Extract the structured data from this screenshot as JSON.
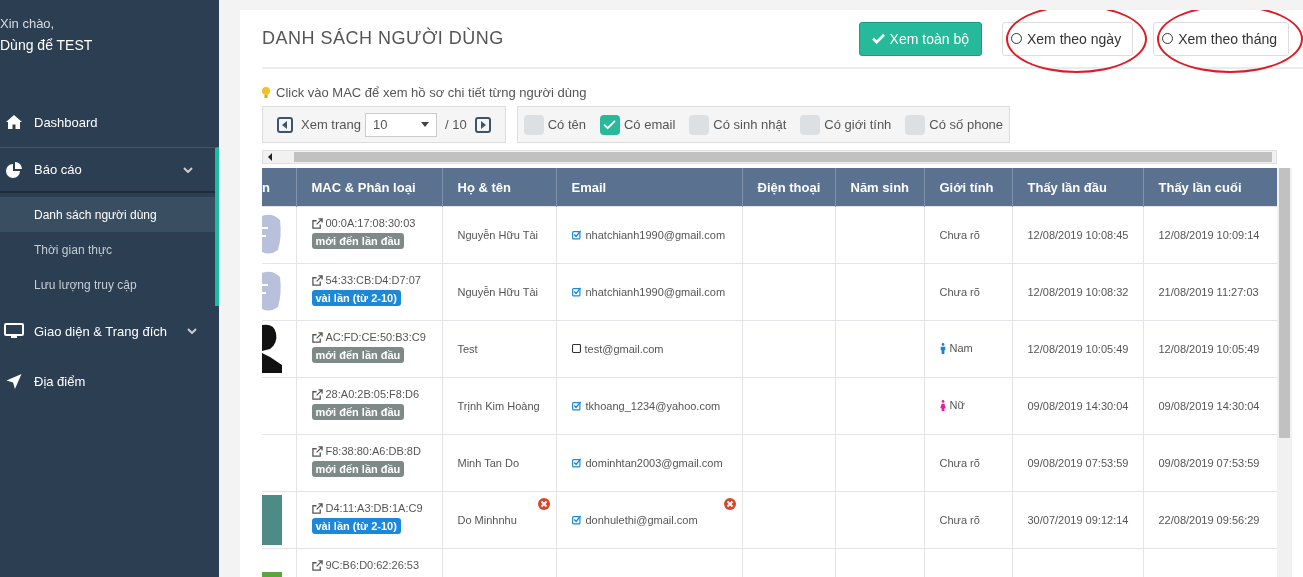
{
  "sidebar": {
    "greeting": "Xin chào,",
    "user": "Dùng để TEST",
    "items": [
      {
        "label": "Dashboard",
        "kind": "home"
      },
      {
        "label": "Báo cáo",
        "kind": "pie",
        "expanded": true,
        "children": [
          {
            "label": "Danh sách người dùng",
            "selected": true
          },
          {
            "label": "Thời gian thực",
            "selected": false
          },
          {
            "label": "Lưu lượng truy cập",
            "selected": false
          }
        ]
      },
      {
        "label": "Giao diện & Trang đích",
        "kind": "monitor",
        "expanded": false
      },
      {
        "label": "Địa điểm",
        "kind": "location"
      }
    ]
  },
  "page": {
    "title": "DANH SÁCH NGƯỜI DÙNG",
    "view_buttons": [
      {
        "label": "Xem toàn bộ",
        "selected": true,
        "highlighted": false
      },
      {
        "label": "Xem theo ngày",
        "selected": false,
        "highlighted": true
      },
      {
        "label": "Xem theo tháng",
        "selected": false,
        "highlighted": true
      }
    ],
    "hint": "Click vào MAC để xem hồ sơ chi tiết từng người dùng",
    "pager": {
      "label": "Xem trang",
      "value": "10",
      "total": "/ 10"
    },
    "filters": [
      {
        "label": "Có tên",
        "checked": false
      },
      {
        "label": "Có email",
        "checked": true
      },
      {
        "label": "Có sinh nhật",
        "checked": false
      },
      {
        "label": "Có giới tính",
        "checked": false
      },
      {
        "label": "Có số phone",
        "checked": false
      }
    ]
  },
  "table": {
    "columns": [
      "n",
      "MAC & Phân loại",
      "Họ & tên",
      "Email",
      "Điện thoại",
      "Năm sinh",
      "Giới tính",
      "Thấy lần đầu",
      "Thấy lần cuối"
    ],
    "rows": [
      {
        "avatar": {
          "kind": "silhouette"
        },
        "mac": "00:0A:17:08:30:03",
        "badge": {
          "label": "mới đến lần đầu",
          "color": "#7d8a87"
        },
        "name": "Nguyễn Hữu Tài",
        "error": false,
        "email": "nhatchianh1990@gmail.com",
        "email_checked": true,
        "gender": {
          "label": "Chưa rõ",
          "kind": "unknown"
        },
        "first_seen": "12/08/2019 10:08:45",
        "last_seen": "12/08/2019 10:09:14"
      },
      {
        "avatar": {
          "kind": "silhouette"
        },
        "mac": "54:33:CB:D4:D7:07",
        "badge": {
          "label": "vài lần (từ 2-10)",
          "color": "#1c88d9"
        },
        "name": "Nguyễn Hữu Tài",
        "error": false,
        "email": "nhatchianh1990@gmail.com",
        "email_checked": true,
        "gender": {
          "label": "Chưa rõ",
          "kind": "unknown"
        },
        "first_seen": "12/08/2019 10:08:32",
        "last_seen": "21/08/2019 11:27:03"
      },
      {
        "avatar": {
          "kind": "person"
        },
        "mac": "AC:FD:CE:50:B3:C9",
        "badge": {
          "label": "mới đến lần đầu",
          "color": "#7d8a87"
        },
        "name": "Test",
        "error": false,
        "email": "test@gmail.com",
        "email_checked": false,
        "gender": {
          "label": "Nam",
          "kind": "male"
        },
        "first_seen": "12/08/2019 10:05:49",
        "last_seen": "12/08/2019 10:05:49"
      },
      {
        "mac": "28:A0:2B:05:F8:D6",
        "badge": {
          "label": "mới đến lần đầu",
          "color": "#7d8a87"
        },
        "name": "Trịnh Kim Hoàng",
        "error": false,
        "email": "tkhoang_1234@yahoo.com",
        "email_checked": true,
        "gender": {
          "label": "Nữ",
          "kind": "female"
        },
        "first_seen": "09/08/2019 14:30:04",
        "last_seen": "09/08/2019 14:30:04"
      },
      {
        "mac": "F8:38:80:A6:DB:8D",
        "badge": {
          "label": "mới đến lần đầu",
          "color": "#7d8a87"
        },
        "name": "Minh Tan Do",
        "error": false,
        "email": "dominhtan2003@gmail.com",
        "email_checked": true,
        "gender": {
          "label": "Chưa rõ",
          "kind": "unknown"
        },
        "first_seen": "09/08/2019 07:53:59",
        "last_seen": "09/08/2019 07:53:59"
      },
      {
        "avatar": {
          "kind": "photo"
        },
        "mac": "D4:11:A3:DB:1A:C9",
        "badge": {
          "label": "vài lần (từ 2-10)",
          "color": "#1c88d9"
        },
        "name": "Do Minhnhu",
        "error": true,
        "email": "donhulethi@gmail.com",
        "email_checked": true,
        "gender": {
          "label": "Chưa rõ",
          "kind": "unknown"
        },
        "first_seen": "30/07/2019 09:12:14",
        "last_seen": "22/08/2019 09:56:29"
      },
      {
        "avatar": {
          "kind": "photo-green"
        },
        "mac": "9C:B6:D0:62:26:53"
      }
    ]
  }
}
